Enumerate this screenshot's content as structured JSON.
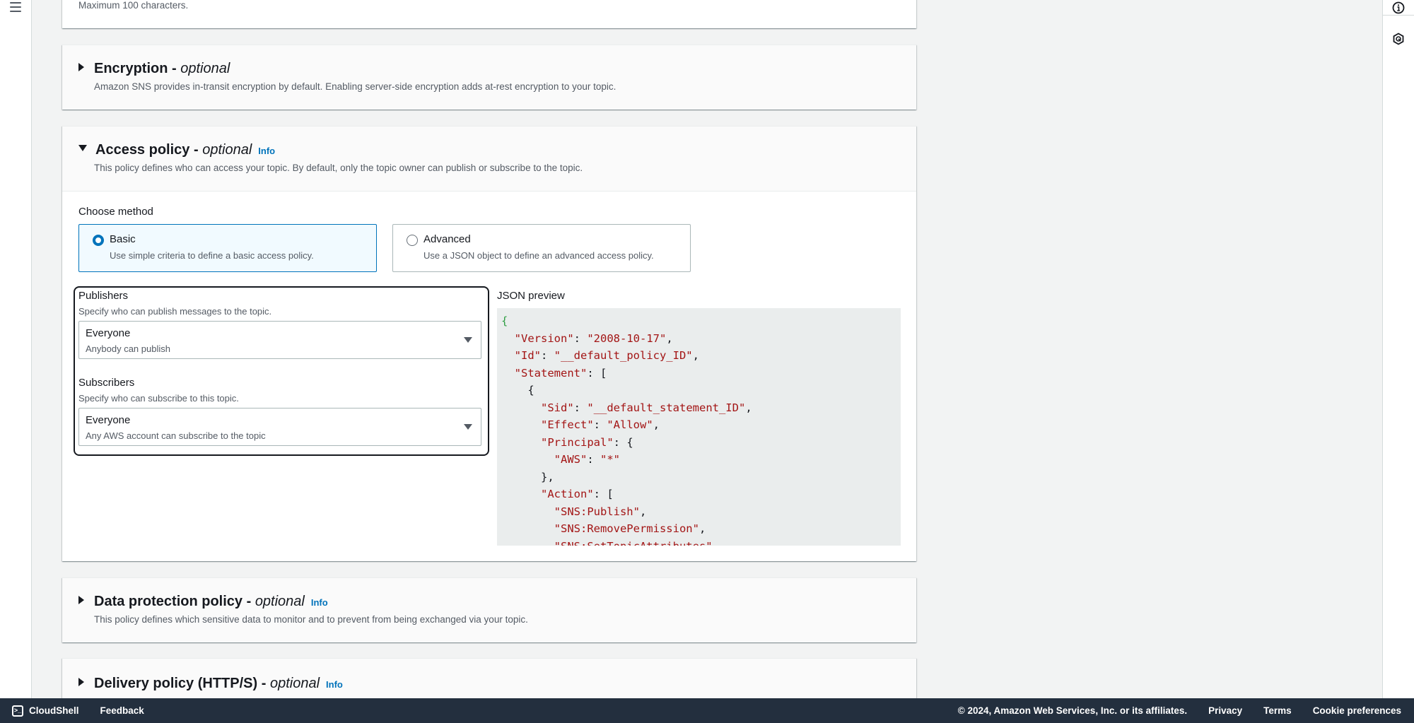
{
  "left_nav": {
    "menu_icon": "hamburger-menu-icon"
  },
  "right_rail": {
    "icons": [
      "info-circle-icon",
      "hexagon-feedback-icon"
    ]
  },
  "name_section": {
    "hint": "Maximum 100 characters."
  },
  "encryption": {
    "title": "Encryption",
    "separator": " - ",
    "optional": "optional",
    "description": "Amazon SNS provides in-transit encryption by default. Enabling server-side encryption adds at-rest encryption to your topic.",
    "expanded": false
  },
  "access_policy": {
    "title": "Access policy",
    "separator": " - ",
    "optional": "optional",
    "info": "Info",
    "description": "This policy defines who can access your topic. By default, only the topic owner can publish or subscribe to the topic.",
    "expanded": true,
    "choose_method_label": "Choose method",
    "methods": [
      {
        "label": "Basic",
        "description": "Use simple criteria to define a basic access policy.",
        "selected": true
      },
      {
        "label": "Advanced",
        "description": "Use a JSON object to define an advanced access policy.",
        "selected": false
      }
    ],
    "publishers": {
      "label": "Publishers",
      "description": "Specify who can publish messages to the topic.",
      "selected_value": "Everyone",
      "selected_description": "Anybody can publish"
    },
    "subscribers": {
      "label": "Subscribers",
      "description": "Specify who can subscribe to this topic.",
      "selected_value": "Everyone",
      "selected_description": "Any AWS account can subscribe to the topic"
    },
    "json_preview_label": "JSON preview",
    "json_preview_lines": [
      "{",
      "  \"Version\": \"2008-10-17\",",
      "  \"Id\": \"__default_policy_ID\",",
      "  \"Statement\": [",
      "    {",
      "      \"Sid\": \"__default_statement_ID\",",
      "      \"Effect\": \"Allow\",",
      "      \"Principal\": {",
      "        \"AWS\": \"*\"",
      "      },",
      "      \"Action\": [",
      "        \"SNS:Publish\",",
      "        \"SNS:RemovePermission\",",
      "        \"SNS:SetTopicAttributes\","
    ]
  },
  "data_protection": {
    "title": "Data protection policy",
    "separator": " - ",
    "optional": "optional",
    "info": "Info",
    "description": "This policy defines which sensitive data to monitor and to prevent from being exchanged via your topic.",
    "expanded": false
  },
  "delivery_policy": {
    "title": "Delivery policy (HTTP/S)",
    "separator": " - ",
    "optional": "optional",
    "info": "Info",
    "expanded": false
  },
  "footer": {
    "cloudshell": "CloudShell",
    "feedback": "Feedback",
    "copyright": "© 2024, Amazon Web Services, Inc. or its affiliates.",
    "privacy": "Privacy",
    "terms": "Terms",
    "cookie_preferences": "Cookie preferences"
  }
}
